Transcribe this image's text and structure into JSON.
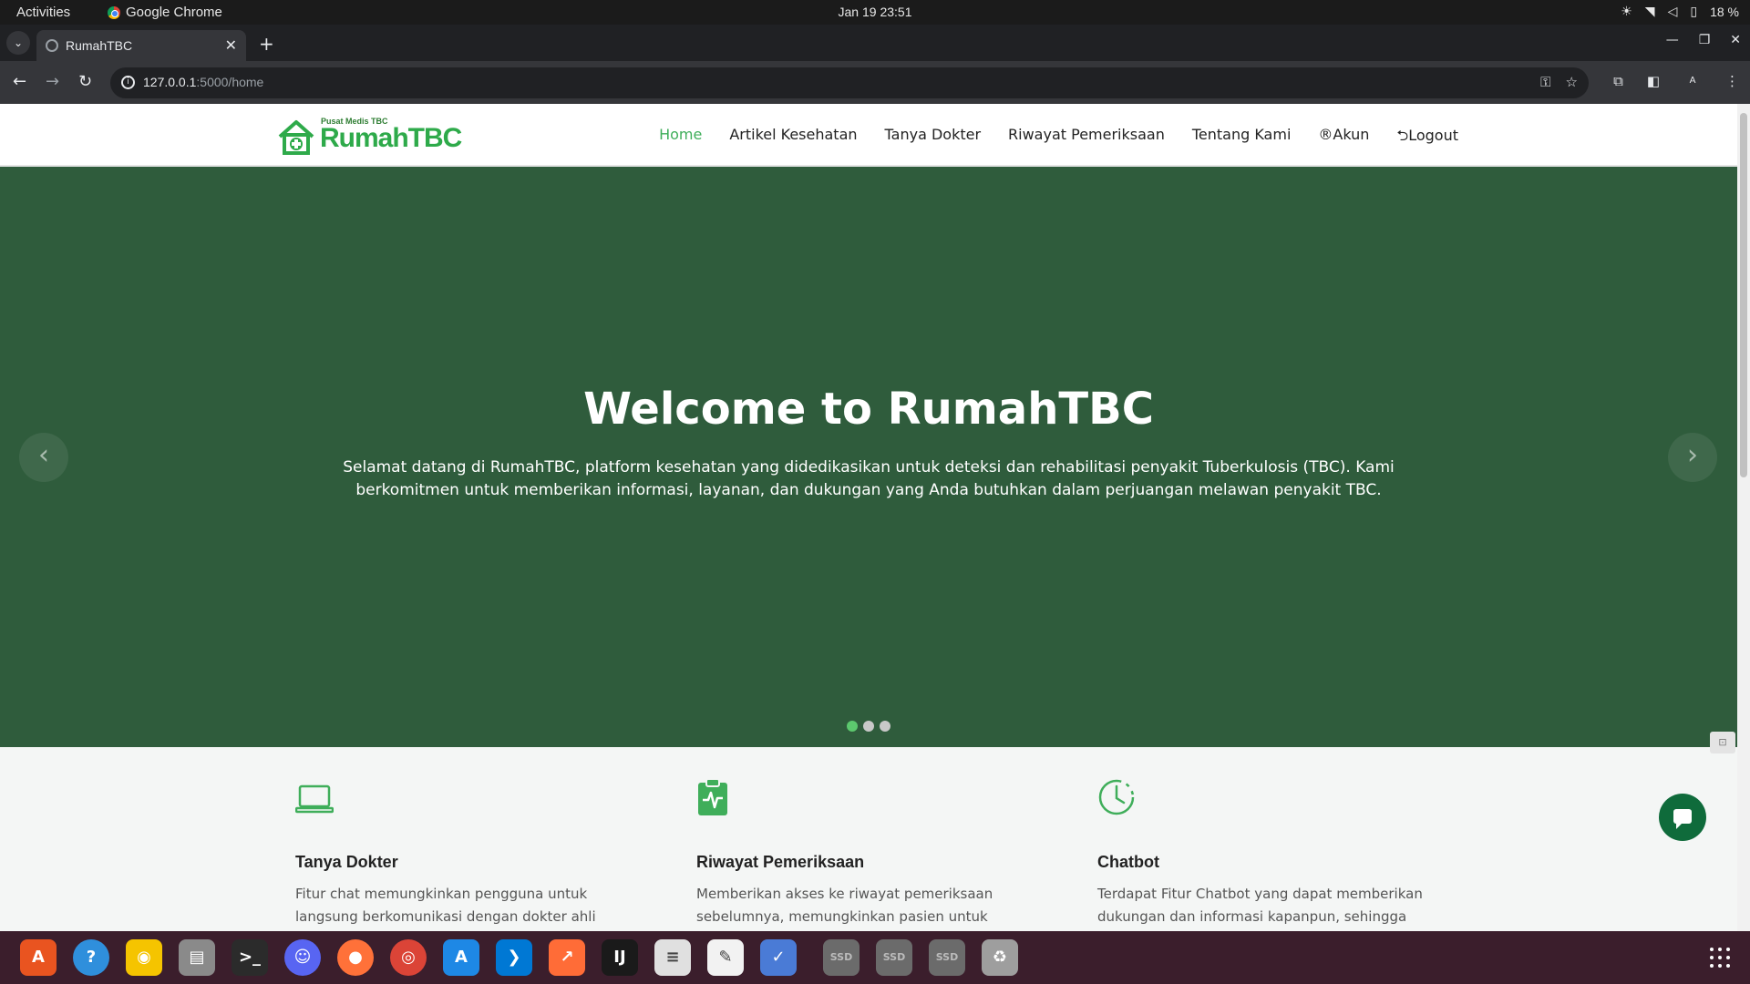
{
  "os": {
    "activities": "Activities",
    "app_name": "Google Chrome",
    "clock": "Jan 19  23:51",
    "battery": "18 %"
  },
  "browser": {
    "tab_title": "RumahTBC",
    "url_host": "127.0.0.1",
    "url_path": ":5000/home",
    "profile_initial": "A"
  },
  "site": {
    "logo_tagline": "Pusat Medis TBC",
    "logo_brand": "RumahTBC",
    "nav": {
      "home": "Home",
      "articles": "Artikel Kesehatan",
      "ask_doctor": "Tanya Dokter",
      "history": "Riwayat Pemeriksaan",
      "about": "Tentang Kami",
      "account": "®Akun",
      "logout": "⮌Logout"
    },
    "hero": {
      "title": "Welcome to RumahTBC",
      "text": "Selamat datang di RumahTBC, platform kesehatan yang didedikasikan untuk deteksi dan rehabilitasi penyakit Tuberkulosis (TBC). Kami berkomitmen untuk memberikan informasi, layanan, dan dukungan yang Anda butuhkan dalam perjuangan melawan penyakit TBC.",
      "slides": 3,
      "active_slide": 1
    },
    "features": [
      {
        "icon": "laptop-icon",
        "title": "Tanya Dokter",
        "text": "Fitur chat memungkinkan pengguna untuk langsung berkomunikasi dengan dokter ahli dalam bidang"
      },
      {
        "icon": "clipboard-pulse-icon",
        "title": "Riwayat Pemeriksaan",
        "text": "Memberikan akses ke riwayat pemeriksaan sebelumnya, memungkinkan pasien untuk melacak"
      },
      {
        "icon": "clock-icon",
        "title": "Chatbot",
        "text": "Terdapat Fitur Chatbot yang dapat memberikan dukungan dan informasi kapanpun, sehingga"
      }
    ]
  },
  "colors": {
    "hero_bg": "#2f5c3c",
    "accent": "#3fae5a",
    "chat_fab": "#0f6b3b"
  },
  "dock": {
    "items": [
      {
        "name": "app-center-icon",
        "glyph": "A",
        "color": "#e95420"
      },
      {
        "name": "help-icon",
        "glyph": "?",
        "color": "#2f8fdc"
      },
      {
        "name": "rhythmbox-icon",
        "glyph": "◉",
        "color": "#f5c400"
      },
      {
        "name": "files-icon",
        "glyph": "▤",
        "color": "#8a8a8a"
      },
      {
        "name": "terminal-icon",
        "glyph": ">_",
        "color": "#2b2b2b"
      },
      {
        "name": "discord-icon",
        "glyph": "☺",
        "color": "#5865f2"
      },
      {
        "name": "firefox-icon",
        "glyph": "●",
        "color": "#ff7139"
      },
      {
        "name": "chrome-icon",
        "glyph": "◎",
        "color": "#db4437"
      },
      {
        "name": "app-store-icon",
        "glyph": "A",
        "color": "#1e88e5"
      },
      {
        "name": "vscode-icon",
        "glyph": "❯",
        "color": "#0078d4"
      },
      {
        "name": "postman-icon",
        "glyph": "↗",
        "color": "#ff6c37"
      },
      {
        "name": "intellij-icon",
        "glyph": "IJ",
        "color": "#1a1a1a"
      },
      {
        "name": "document-viewer-icon",
        "glyph": "≡",
        "color": "#e0e0e0"
      },
      {
        "name": "text-editor-icon",
        "glyph": "✎",
        "color": "#f2f2f2"
      },
      {
        "name": "todo-icon",
        "glyph": "✓",
        "color": "#4a7bd6"
      },
      {
        "name": "ssd-drive-icon-1",
        "glyph": "SSD",
        "color": "#6b6b6b"
      },
      {
        "name": "ssd-drive-icon-2",
        "glyph": "SSD",
        "color": "#6b6b6b"
      },
      {
        "name": "ssd-drive-icon-3",
        "glyph": "SSD",
        "color": "#6b6b6b"
      },
      {
        "name": "trash-icon",
        "glyph": "♻",
        "color": "#9e9e9e"
      }
    ]
  }
}
